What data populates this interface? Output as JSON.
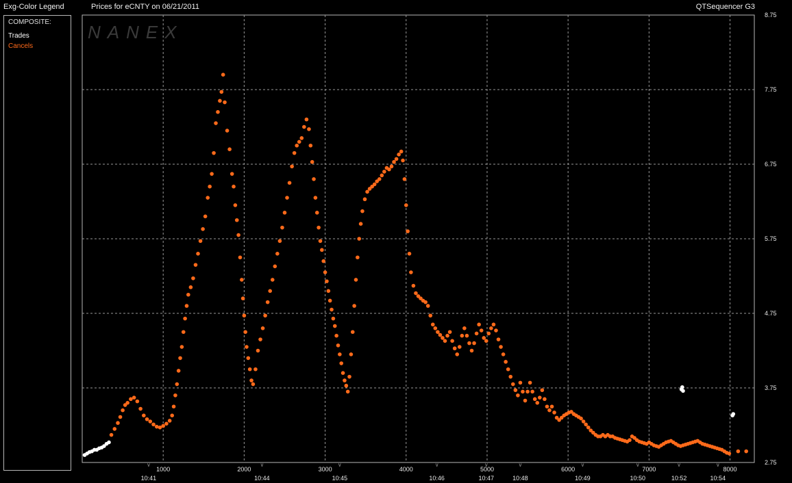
{
  "header": {
    "legend_title": "Exg-Color Legend",
    "chart_title": "Prices for  eCNTY  on  06/21/2011",
    "app_name": "QTSequencer G3"
  },
  "legend": {
    "heading": "COMPOSITE:",
    "items": [
      {
        "label": "Trades",
        "color": "#ffffff"
      },
      {
        "label": "Cancels",
        "color": "#ff6a1a"
      }
    ]
  },
  "watermark": "NANEX",
  "colors": {
    "background": "#000000",
    "grid": "#9a9a9a",
    "trades": "#ffffff",
    "cancels": "#ff6a1a",
    "axis_text": "#e8e8e8"
  },
  "chart_data": {
    "type": "scatter",
    "title": "Prices for  eCNTY  on  06/21/2011",
    "xlim": [
      0,
      8300
    ],
    "ylim": [
      2.75,
      8.75
    ],
    "grid": true,
    "legend_position": "left panel",
    "x_ticks": [
      1000,
      2000,
      3000,
      4000,
      5000,
      6000,
      7000,
      8000
    ],
    "y_ticks": [
      2.75,
      3.75,
      4.75,
      5.75,
      6.75,
      7.75,
      8.75
    ],
    "y_tick_labels": [
      "2.75",
      "3.75",
      "4.75",
      "5.75",
      "6.75",
      "7.75",
      "8.75"
    ],
    "time_labels": [
      {
        "x": 820,
        "label": "10:41"
      },
      {
        "x": 2220,
        "label": "10:44"
      },
      {
        "x": 3180,
        "label": "10:45"
      },
      {
        "x": 4380,
        "label": "10:46"
      },
      {
        "x": 4990,
        "label": "10:47"
      },
      {
        "x": 5410,
        "label": "10:48"
      },
      {
        "x": 6180,
        "label": "10:49"
      },
      {
        "x": 6860,
        "label": "10:50"
      },
      {
        "x": 7370,
        "label": "10:52"
      },
      {
        "x": 7850,
        "label": "10:54"
      }
    ],
    "series": [
      {
        "name": "Trades",
        "color": "#ffffff",
        "points": [
          [
            30,
            2.85
          ],
          [
            60,
            2.87
          ],
          [
            90,
            2.89
          ],
          [
            120,
            2.9
          ],
          [
            150,
            2.92
          ],
          [
            180,
            2.92
          ],
          [
            210,
            2.94
          ],
          [
            240,
            2.95
          ],
          [
            270,
            2.97
          ],
          [
            300,
            3.0
          ],
          [
            330,
            3.02
          ],
          [
            7400,
            3.73
          ],
          [
            7410,
            3.76
          ],
          [
            7420,
            3.71
          ],
          [
            8030,
            3.38
          ],
          [
            8040,
            3.4
          ]
        ]
      },
      {
        "name": "Cancels",
        "color": "#ff6a1a",
        "points": [
          [
            360,
            3.12
          ],
          [
            400,
            3.2
          ],
          [
            440,
            3.28
          ],
          [
            470,
            3.36
          ],
          [
            500,
            3.45
          ],
          [
            530,
            3.52
          ],
          [
            560,
            3.55
          ],
          [
            600,
            3.6
          ],
          [
            640,
            3.62
          ],
          [
            680,
            3.57
          ],
          [
            720,
            3.47
          ],
          [
            760,
            3.38
          ],
          [
            800,
            3.33
          ],
          [
            840,
            3.3
          ],
          [
            880,
            3.26
          ],
          [
            920,
            3.23
          ],
          [
            960,
            3.22
          ],
          [
            1000,
            3.24
          ],
          [
            1040,
            3.27
          ],
          [
            1080,
            3.31
          ],
          [
            1110,
            3.38
          ],
          [
            1130,
            3.5
          ],
          [
            1150,
            3.65
          ],
          [
            1170,
            3.8
          ],
          [
            1190,
            3.98
          ],
          [
            1210,
            4.15
          ],
          [
            1230,
            4.3
          ],
          [
            1250,
            4.5
          ],
          [
            1270,
            4.68
          ],
          [
            1290,
            4.85
          ],
          [
            1310,
            5.0
          ],
          [
            1340,
            5.1
          ],
          [
            1370,
            5.22
          ],
          [
            1400,
            5.4
          ],
          [
            1430,
            5.55
          ],
          [
            1460,
            5.72
          ],
          [
            1490,
            5.88
          ],
          [
            1520,
            6.05
          ],
          [
            1550,
            6.3
          ],
          [
            1575,
            6.45
          ],
          [
            1600,
            6.62
          ],
          [
            1625,
            6.9
          ],
          [
            1650,
            7.3
          ],
          [
            1675,
            7.45
          ],
          [
            1700,
            7.6
          ],
          [
            1720,
            7.72
          ],
          [
            1740,
            7.95
          ],
          [
            1760,
            7.58
          ],
          [
            1790,
            7.2
          ],
          [
            1820,
            6.95
          ],
          [
            1850,
            6.62
          ],
          [
            1870,
            6.45
          ],
          [
            1890,
            6.2
          ],
          [
            1910,
            6.0
          ],
          [
            1930,
            5.8
          ],
          [
            1950,
            5.5
          ],
          [
            1970,
            5.2
          ],
          [
            1985,
            4.95
          ],
          [
            2000,
            4.72
          ],
          [
            2015,
            4.5
          ],
          [
            2030,
            4.3
          ],
          [
            2050,
            4.15
          ],
          [
            2070,
            4.0
          ],
          [
            2090,
            3.85
          ],
          [
            2110,
            3.8
          ],
          [
            2140,
            4.0
          ],
          [
            2170,
            4.25
          ],
          [
            2200,
            4.4
          ],
          [
            2230,
            4.55
          ],
          [
            2260,
            4.72
          ],
          [
            2290,
            4.9
          ],
          [
            2320,
            5.05
          ],
          [
            2350,
            5.2
          ],
          [
            2380,
            5.38
          ],
          [
            2410,
            5.55
          ],
          [
            2440,
            5.72
          ],
          [
            2470,
            5.9
          ],
          [
            2500,
            6.1
          ],
          [
            2530,
            6.3
          ],
          [
            2560,
            6.5
          ],
          [
            2590,
            6.72
          ],
          [
            2620,
            6.9
          ],
          [
            2650,
            7.0
          ],
          [
            2680,
            7.05
          ],
          [
            2710,
            7.1
          ],
          [
            2740,
            7.25
          ],
          [
            2770,
            7.35
          ],
          [
            2800,
            7.22
          ],
          [
            2820,
            7.0
          ],
          [
            2840,
            6.78
          ],
          [
            2860,
            6.55
          ],
          [
            2880,
            6.3
          ],
          [
            2900,
            6.1
          ],
          [
            2920,
            5.9
          ],
          [
            2940,
            5.72
          ],
          [
            2960,
            5.6
          ],
          [
            2980,
            5.45
          ],
          [
            3000,
            5.3
          ],
          [
            3020,
            5.18
          ],
          [
            3040,
            5.05
          ],
          [
            3060,
            4.92
          ],
          [
            3080,
            4.8
          ],
          [
            3100,
            4.68
          ],
          [
            3120,
            4.58
          ],
          [
            3140,
            4.45
          ],
          [
            3160,
            4.32
          ],
          [
            3180,
            4.2
          ],
          [
            3200,
            4.08
          ],
          [
            3220,
            3.95
          ],
          [
            3240,
            3.85
          ],
          [
            3260,
            3.78
          ],
          [
            3280,
            3.7
          ],
          [
            3300,
            3.9
          ],
          [
            3320,
            4.2
          ],
          [
            3340,
            4.5
          ],
          [
            3360,
            4.85
          ],
          [
            3380,
            5.2
          ],
          [
            3400,
            5.5
          ],
          [
            3420,
            5.75
          ],
          [
            3440,
            5.95
          ],
          [
            3460,
            6.12
          ],
          [
            3490,
            6.28
          ],
          [
            3520,
            6.38
          ],
          [
            3550,
            6.42
          ],
          [
            3580,
            6.45
          ],
          [
            3610,
            6.48
          ],
          [
            3640,
            6.52
          ],
          [
            3670,
            6.55
          ],
          [
            3700,
            6.6
          ],
          [
            3730,
            6.65
          ],
          [
            3760,
            6.7
          ],
          [
            3790,
            6.68
          ],
          [
            3820,
            6.72
          ],
          [
            3850,
            6.78
          ],
          [
            3880,
            6.82
          ],
          [
            3910,
            6.88
          ],
          [
            3940,
            6.92
          ],
          [
            3960,
            6.8
          ],
          [
            3980,
            6.55
          ],
          [
            4000,
            6.2
          ],
          [
            4020,
            5.85
          ],
          [
            4040,
            5.55
          ],
          [
            4060,
            5.3
          ],
          [
            4090,
            5.12
          ],
          [
            4120,
            5.02
          ],
          [
            4150,
            4.98
          ],
          [
            4180,
            4.95
          ],
          [
            4210,
            4.92
          ],
          [
            4240,
            4.9
          ],
          [
            4270,
            4.85
          ],
          [
            4300,
            4.72
          ],
          [
            4330,
            4.6
          ],
          [
            4360,
            4.55
          ],
          [
            4390,
            4.5
          ],
          [
            4420,
            4.46
          ],
          [
            4450,
            4.42
          ],
          [
            4480,
            4.38
          ],
          [
            4510,
            4.45
          ],
          [
            4540,
            4.5
          ],
          [
            4570,
            4.38
          ],
          [
            4600,
            4.28
          ],
          [
            4630,
            4.2
          ],
          [
            4660,
            4.3
          ],
          [
            4690,
            4.45
          ],
          [
            4720,
            4.55
          ],
          [
            4750,
            4.45
          ],
          [
            4780,
            4.35
          ],
          [
            4810,
            4.25
          ],
          [
            4840,
            4.35
          ],
          [
            4870,
            4.48
          ],
          [
            4900,
            4.6
          ],
          [
            4930,
            4.52
          ],
          [
            4960,
            4.42
          ],
          [
            4990,
            4.38
          ],
          [
            5020,
            4.48
          ],
          [
            5050,
            4.55
          ],
          [
            5080,
            4.6
          ],
          [
            5110,
            4.52
          ],
          [
            5140,
            4.4
          ],
          [
            5170,
            4.3
          ],
          [
            5200,
            4.2
          ],
          [
            5230,
            4.1
          ],
          [
            5260,
            4.0
          ],
          [
            5290,
            3.9
          ],
          [
            5320,
            3.8
          ],
          [
            5350,
            3.72
          ],
          [
            5380,
            3.65
          ],
          [
            5410,
            3.82
          ],
          [
            5440,
            3.7
          ],
          [
            5470,
            3.58
          ],
          [
            5500,
            3.7
          ],
          [
            5530,
            3.82
          ],
          [
            5560,
            3.7
          ],
          [
            5590,
            3.6
          ],
          [
            5620,
            3.55
          ],
          [
            5650,
            3.62
          ],
          [
            5680,
            3.72
          ],
          [
            5710,
            3.6
          ],
          [
            5740,
            3.5
          ],
          [
            5770,
            3.45
          ],
          [
            5800,
            3.5
          ],
          [
            5830,
            3.42
          ],
          [
            5860,
            3.35
          ],
          [
            5890,
            3.32
          ],
          [
            5920,
            3.35
          ],
          [
            5950,
            3.38
          ],
          [
            5980,
            3.4
          ],
          [
            6010,
            3.42
          ],
          [
            6040,
            3.43
          ],
          [
            6070,
            3.4
          ],
          [
            6100,
            3.38
          ],
          [
            6130,
            3.36
          ],
          [
            6160,
            3.34
          ],
          [
            6190,
            3.3
          ],
          [
            6220,
            3.26
          ],
          [
            6250,
            3.22
          ],
          [
            6280,
            3.18
          ],
          [
            6310,
            3.15
          ],
          [
            6340,
            3.12
          ],
          [
            6370,
            3.1
          ],
          [
            6400,
            3.1
          ],
          [
            6430,
            3.12
          ],
          [
            6460,
            3.1
          ],
          [
            6490,
            3.12
          ],
          [
            6520,
            3.1
          ],
          [
            6550,
            3.1
          ],
          [
            6580,
            3.08
          ],
          [
            6610,
            3.07
          ],
          [
            6640,
            3.06
          ],
          [
            6670,
            3.05
          ],
          [
            6700,
            3.04
          ],
          [
            6730,
            3.03
          ],
          [
            6760,
            3.05
          ],
          [
            6790,
            3.1
          ],
          [
            6820,
            3.08
          ],
          [
            6850,
            3.05
          ],
          [
            6880,
            3.03
          ],
          [
            6910,
            3.02
          ],
          [
            6940,
            3.01
          ],
          [
            6970,
            3.0
          ],
          [
            7000,
            3.02
          ],
          [
            7030,
            3.0
          ],
          [
            7060,
            2.98
          ],
          [
            7090,
            2.97
          ],
          [
            7120,
            2.96
          ],
          [
            7150,
            2.98
          ],
          [
            7180,
            3.0
          ],
          [
            7210,
            3.02
          ],
          [
            7240,
            3.03
          ],
          [
            7270,
            3.04
          ],
          [
            7300,
            3.02
          ],
          [
            7330,
            3.0
          ],
          [
            7360,
            2.98
          ],
          [
            7390,
            2.97
          ],
          [
            7420,
            2.98
          ],
          [
            7450,
            2.99
          ],
          [
            7480,
            3.0
          ],
          [
            7510,
            3.01
          ],
          [
            7540,
            3.02
          ],
          [
            7570,
            3.03
          ],
          [
            7600,
            3.04
          ],
          [
            7630,
            3.02
          ],
          [
            7660,
            3.0
          ],
          [
            7690,
            2.99
          ],
          [
            7720,
            2.98
          ],
          [
            7750,
            2.97
          ],
          [
            7780,
            2.96
          ],
          [
            7810,
            2.95
          ],
          [
            7840,
            2.94
          ],
          [
            7870,
            2.93
          ],
          [
            7900,
            2.92
          ],
          [
            7930,
            2.9
          ],
          [
            7960,
            2.88
          ],
          [
            7990,
            2.87
          ],
          [
            8100,
            2.9
          ],
          [
            8200,
            2.9
          ]
        ]
      }
    ]
  }
}
